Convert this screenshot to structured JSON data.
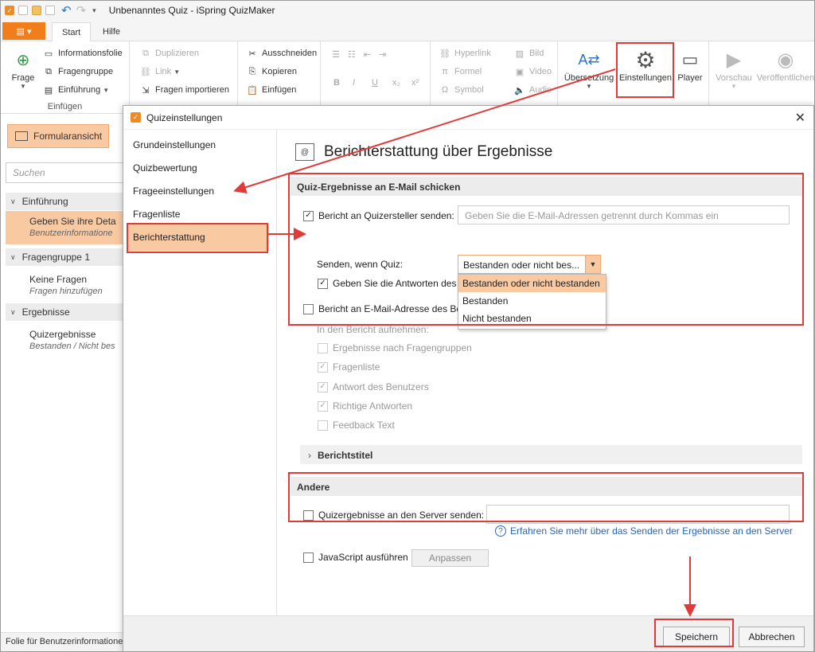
{
  "titlebar": {
    "title": "Unbenanntes Quiz - iSpring QuizMaker"
  },
  "tabs": {
    "start": "Start",
    "help": "Hilfe"
  },
  "ribbon": {
    "insert": {
      "frage": "Frage",
      "informationsfolie": "Informationsfolie",
      "fragengruppe": "Fragengruppe",
      "einfuehrung": "Einführung",
      "label": "Einfügen"
    },
    "edit": {
      "duplizieren": "Duplizieren",
      "link": "Link",
      "fragen_importieren": "Fragen importieren"
    },
    "clipboard": {
      "ausschneiden": "Ausschneiden",
      "kopieren": "Kopieren",
      "einfuegen": "Einfügen"
    },
    "format": {
      "b": "B",
      "i": "I",
      "u": "U",
      "sub": "x₂",
      "sup": "x²"
    },
    "insert2": {
      "hyperlink": "Hyperlink",
      "formel": "Formel",
      "symbol": "Symbol",
      "bild": "Bild",
      "video": "Video",
      "audio": "Audio"
    },
    "quiz": {
      "uebersetzung": "Übersetzung",
      "einstellungen": "Einstellungen",
      "player": "Player"
    },
    "publish": {
      "vorschau": "Vorschau",
      "veroeffentlichen": "Veröffentlichen"
    }
  },
  "leftpane": {
    "form_view": "Formularansicht",
    "search_placeholder": "Suchen",
    "groups": [
      {
        "label": "Einführung"
      },
      {
        "label": "Fragengruppe 1"
      },
      {
        "label": "Ergebnisse"
      }
    ],
    "items": [
      {
        "title": "Geben Sie ihre Deta",
        "sub": "Benutzerinformatione"
      },
      {
        "title": "Keine Fragen",
        "sub": "Fragen hinzufügen"
      },
      {
        "title": "Quizergebnisse",
        "sub": "Bestanden / Nicht bes"
      }
    ],
    "status": "Folie für Benutzerinformationen"
  },
  "dialog": {
    "title": "Quizeinstellungen",
    "nav": [
      "Grundeinstellungen",
      "Quizbewertung",
      "Frageeinstellungen",
      "Fragenliste",
      "Berichterstattung"
    ],
    "selected_nav": "Berichterstattung",
    "page_title": "Berichterstattung über Ergebnisse",
    "email_section": "Quiz-Ergebnisse an E-Mail schicken",
    "report_to_author": "Bericht an Quizersteller senden:",
    "email_placeholder": "Geben Sie die E-Mail-Adressen getrennt durch Kommas ein",
    "send_when": "Senden, wenn Quiz:",
    "send_when_value": "Bestanden oder nicht bes...",
    "send_when_options": [
      "Bestanden oder nicht bestanden",
      "Bestanden",
      "Nicht bestanden"
    ],
    "include_answers": "Geben Sie die Antworten des",
    "report_to_email": "Bericht an E-Mail-Adresse des Be",
    "include_label": "In den Bericht aufnehmen:",
    "include_items": [
      "Ergebnisse nach Fragengruppen",
      "Fragenliste",
      "Antwort des Benutzers",
      "Richtige Antworten",
      "Feedback Text"
    ],
    "report_title": "Berichtstitel",
    "other_section": "Andere",
    "send_to_server": "Quizergebnisse an den Server senden:",
    "learn_more": "Erfahren Sie mehr über das Senden der Ergebnisse an den Server",
    "run_js": "JavaScript ausführen",
    "customize": "Anpassen",
    "save": "Speichern",
    "cancel": "Abbrechen"
  },
  "colors": {
    "accent": "#f07e1b",
    "selection": "#f9c9a2",
    "annotation": "#e03a3a",
    "link": "#2a64b8"
  }
}
